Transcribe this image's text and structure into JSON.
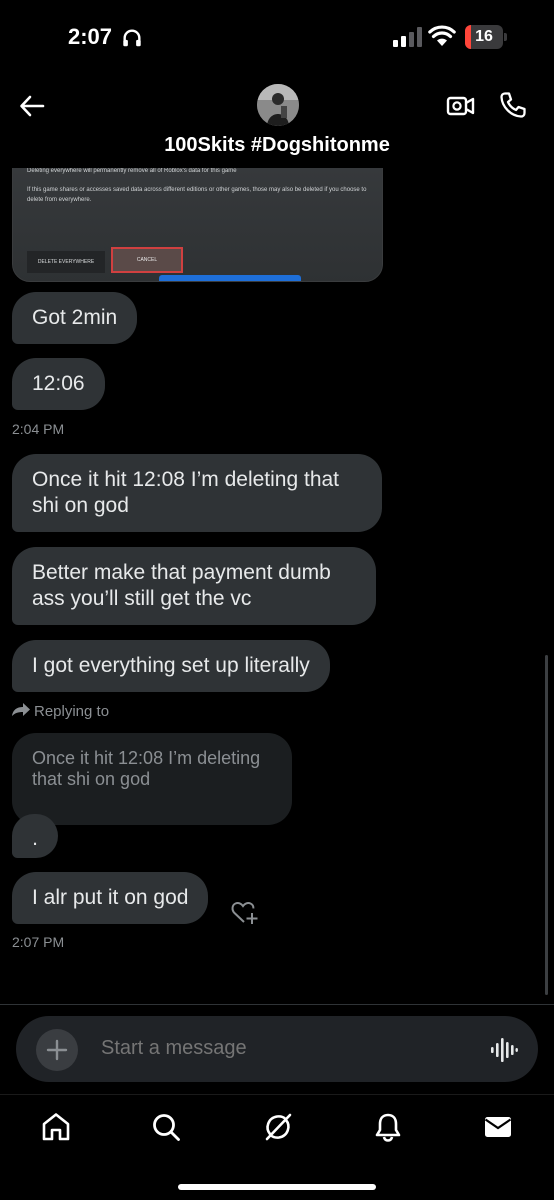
{
  "status_bar": {
    "time": "2:07",
    "battery": "16",
    "battery_level": 0.16
  },
  "header": {
    "contact_name": "100Skits #Dogshitonme"
  },
  "image_message": {
    "line1": "Deleting everywhere will permanently remove all of Roblox's data for this game",
    "line2": "If this game shares or accesses saved data across different editions or other games, those may also be deleted if you choose to delete from everywhere.",
    "delete_button": "DELETE EVERYWHERE",
    "cancel_button": "CANCEL"
  },
  "messages": [
    {
      "text": "Got 2min"
    },
    {
      "text": "12:06"
    },
    {
      "text": "Once it hit 12:08 I’m deleting that shi on god"
    },
    {
      "text": "Better make that payment dumb ass you’ll still get the vc"
    },
    {
      "text": "I got everything set up literally"
    },
    {
      "text": "."
    },
    {
      "text": "I alr put it on god"
    }
  ],
  "timestamps": [
    "2:04 PM",
    "2:07 PM"
  ],
  "reply": {
    "label": "Replying to",
    "quoted_text": "Once it hit 12:08 I’m deleting that shi on god"
  },
  "composer": {
    "placeholder": "Start a message"
  },
  "bottom_nav": {
    "items": [
      "home-icon",
      "search-icon",
      "grok-icon",
      "notifications-icon",
      "messages-icon"
    ]
  }
}
